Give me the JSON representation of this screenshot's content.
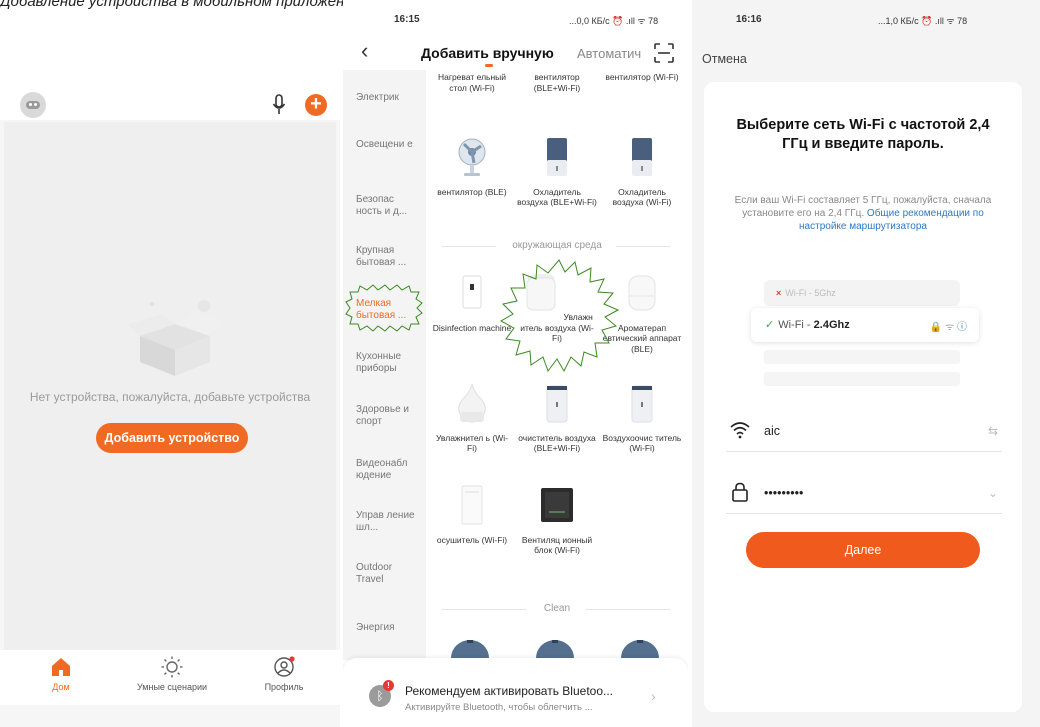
{
  "caption": "Добавление устройства в мобильном приложении",
  "colors": {
    "accent": "#f06a24",
    "link": "#2f78c4",
    "highlight": "#3a8a1e"
  },
  "home": {
    "empty_text": "Нет устройства, пожалуйста, добавьте устройства",
    "add_button": "Добавить устройство",
    "tabs": [
      {
        "label": "Дом",
        "icon": "home-icon",
        "active": true
      },
      {
        "label": "Умные сценарии",
        "icon": "sun-icon",
        "active": false
      },
      {
        "label": "Профиль",
        "icon": "profile-icon",
        "active": false
      }
    ]
  },
  "add_device": {
    "status": {
      "time": "16:15",
      "right": "...0,0 КБ/с ⏰ .ıll ᯤ 78"
    },
    "tab_manual": "Добавить вручную",
    "tab_auto": "Автоматич",
    "categories": [
      {
        "label": "Электрик",
        "active": false
      },
      {
        "label": "Освещени е",
        "active": false
      },
      {
        "label": "Безопас ность и д...",
        "active": false
      },
      {
        "label": "Крупная бытовая ...",
        "active": false
      },
      {
        "label": "Мелкая бытовая ...",
        "active": true
      },
      {
        "label": "Кухонные приборы",
        "active": false
      },
      {
        "label": "Здоровье и спорт",
        "active": false
      },
      {
        "label": "Видеонабл юдение",
        "active": false
      },
      {
        "label": "Управ ление шл...",
        "active": false
      },
      {
        "label": "Outdoor Travel",
        "active": false
      },
      {
        "label": "Энергия",
        "active": false
      }
    ],
    "devices_top": [
      {
        "label": "Нагреват ельный стол (Wi-Fi)"
      },
      {
        "label": "вентилятор (BLE+Wi-Fi)"
      },
      {
        "label": "вентилятор (Wi-Fi)"
      },
      {
        "label": "вентилятор (BLE)",
        "icon": "fan-icon"
      },
      {
        "label": "Охладитель воздуха (BLE+Wi-Fi)",
        "icon": "cooler-icon"
      },
      {
        "label": "Охладитель воздуха (Wi-Fi)",
        "icon": "cooler-icon"
      }
    ],
    "section_env": "окружающая среда",
    "devices_env": [
      {
        "label": "Disinfection machine",
        "icon": "disinfection-icon"
      },
      {
        "label": "Увлажн итель воздуха (Wi-Fi)",
        "icon": "humidifier-icon",
        "highlighted": true
      },
      {
        "label": "Ароматерап евтический аппарат (BLE)",
        "icon": "aroma-icon"
      },
      {
        "label": "Увлажнител ь (Wi-Fi)",
        "icon": "humidifier-drop-icon"
      },
      {
        "label": "очиститель воздуха (BLE+Wi-Fi)",
        "icon": "purifier-icon"
      },
      {
        "label": "Воздухоочис титель (Wi-Fi)",
        "icon": "purifier-icon"
      },
      {
        "label": "осушитель (Wi-Fi)",
        "icon": "dehumidifier-icon"
      },
      {
        "label": "Вентиляц ионный блок (Wi-Fi)",
        "icon": "ventilation-icon"
      }
    ],
    "section_clean": "Clean",
    "bluetooth": {
      "badge": "!",
      "title": "Рекомендуем активировать Bluetoo...",
      "subtitle": "Активируйте Bluetooth, чтобы облегчить ..."
    }
  },
  "wifi": {
    "status": {
      "time": "16:16",
      "right": "...1,0 КБ/с ⏰ .ıll ᯤ 78"
    },
    "cancel": "Отмена",
    "title": "Выберите сеть Wi-Fi с частотой 2,4 ГГц и введите пароль.",
    "desc": "Если ваш Wi-Fi составляет 5 ГГц, пожалуйста, сначала установите его на 2,4 ГГц.",
    "link": "Общие рекомендации по настройке маршрутизатора",
    "bad_prefix": "Wi-Fi - ",
    "bad_band": "5Ghz",
    "good_prefix": "Wi-Fi - ",
    "good_band": "2.4Ghz",
    "ssid": "aic",
    "password_mask": "•••••••••",
    "next_button": "Далее"
  }
}
